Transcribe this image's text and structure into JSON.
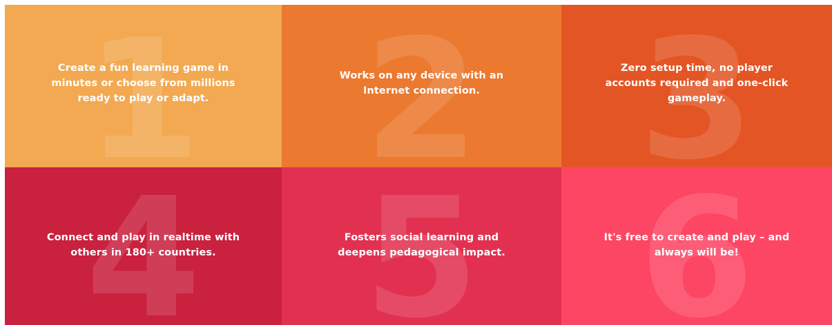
{
  "features": [
    {
      "number": "1",
      "color": "#f3a951",
      "lines": [
        "Create a fun learning game in",
        "minutes or choose from millions",
        "ready to play or adapt."
      ]
    },
    {
      "number": "2",
      "color": "#eb792f",
      "lines": [
        "Works on any device with an",
        "Internet connection."
      ]
    },
    {
      "number": "3",
      "color": "#e45525",
      "lines": [
        "Zero setup time, no player",
        "accounts required and one-click",
        "gameplay."
      ]
    },
    {
      "number": "4",
      "color": "#c9213e",
      "lines": [
        "Connect and play in realtime with",
        "others in 180+ countries."
      ]
    },
    {
      "number": "5",
      "color": "#e23150",
      "lines": [
        "Fosters social learning and",
        "deepens pedagogical impact."
      ]
    },
    {
      "number": "6",
      "color": "#fd4663",
      "lines": [
        "It's free to create and play – and",
        "always will be!"
      ]
    }
  ]
}
